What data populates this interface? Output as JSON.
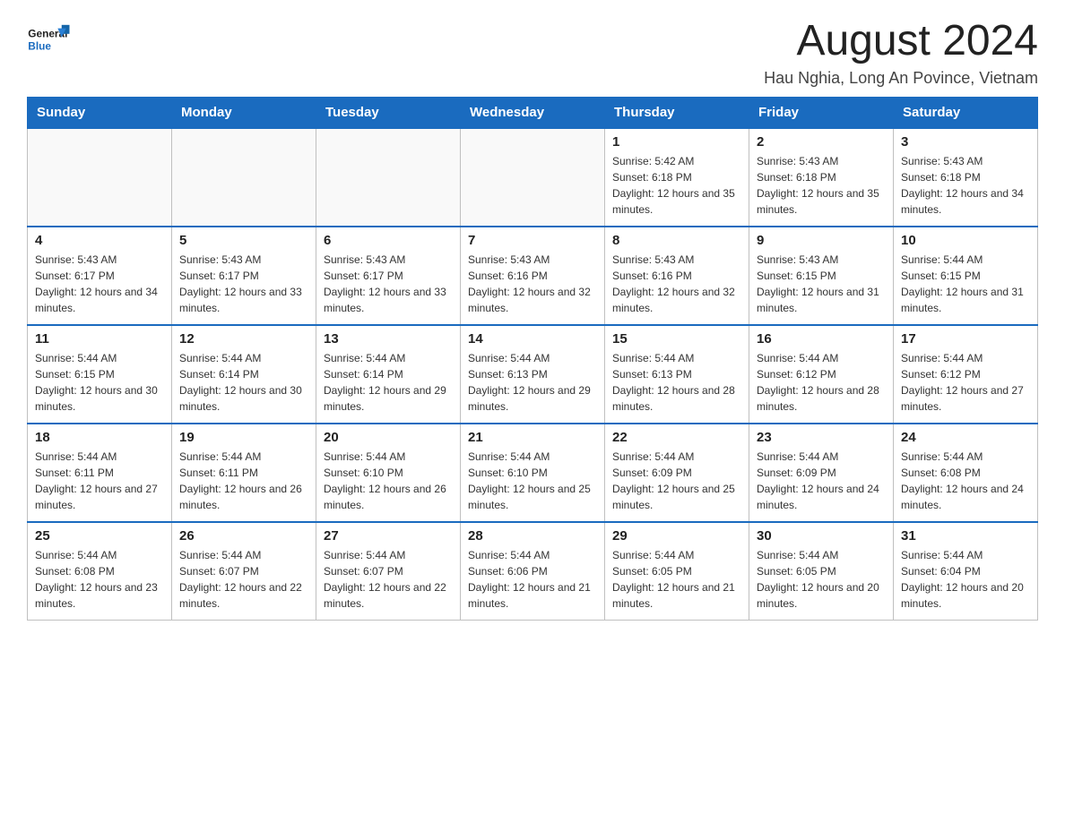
{
  "header": {
    "title": "August 2024",
    "subtitle": "Hau Nghia, Long An Povince, Vietnam"
  },
  "weekdays": [
    "Sunday",
    "Monday",
    "Tuesday",
    "Wednesday",
    "Thursday",
    "Friday",
    "Saturday"
  ],
  "weeks": [
    [
      {
        "day": "",
        "sunrise": "",
        "sunset": "",
        "daylight": ""
      },
      {
        "day": "",
        "sunrise": "",
        "sunset": "",
        "daylight": ""
      },
      {
        "day": "",
        "sunrise": "",
        "sunset": "",
        "daylight": ""
      },
      {
        "day": "",
        "sunrise": "",
        "sunset": "",
        "daylight": ""
      },
      {
        "day": "1",
        "sunrise": "Sunrise: 5:42 AM",
        "sunset": "Sunset: 6:18 PM",
        "daylight": "Daylight: 12 hours and 35 minutes."
      },
      {
        "day": "2",
        "sunrise": "Sunrise: 5:43 AM",
        "sunset": "Sunset: 6:18 PM",
        "daylight": "Daylight: 12 hours and 35 minutes."
      },
      {
        "day": "3",
        "sunrise": "Sunrise: 5:43 AM",
        "sunset": "Sunset: 6:18 PM",
        "daylight": "Daylight: 12 hours and 34 minutes."
      }
    ],
    [
      {
        "day": "4",
        "sunrise": "Sunrise: 5:43 AM",
        "sunset": "Sunset: 6:17 PM",
        "daylight": "Daylight: 12 hours and 34 minutes."
      },
      {
        "day": "5",
        "sunrise": "Sunrise: 5:43 AM",
        "sunset": "Sunset: 6:17 PM",
        "daylight": "Daylight: 12 hours and 33 minutes."
      },
      {
        "day": "6",
        "sunrise": "Sunrise: 5:43 AM",
        "sunset": "Sunset: 6:17 PM",
        "daylight": "Daylight: 12 hours and 33 minutes."
      },
      {
        "day": "7",
        "sunrise": "Sunrise: 5:43 AM",
        "sunset": "Sunset: 6:16 PM",
        "daylight": "Daylight: 12 hours and 32 minutes."
      },
      {
        "day": "8",
        "sunrise": "Sunrise: 5:43 AM",
        "sunset": "Sunset: 6:16 PM",
        "daylight": "Daylight: 12 hours and 32 minutes."
      },
      {
        "day": "9",
        "sunrise": "Sunrise: 5:43 AM",
        "sunset": "Sunset: 6:15 PM",
        "daylight": "Daylight: 12 hours and 31 minutes."
      },
      {
        "day": "10",
        "sunrise": "Sunrise: 5:44 AM",
        "sunset": "Sunset: 6:15 PM",
        "daylight": "Daylight: 12 hours and 31 minutes."
      }
    ],
    [
      {
        "day": "11",
        "sunrise": "Sunrise: 5:44 AM",
        "sunset": "Sunset: 6:15 PM",
        "daylight": "Daylight: 12 hours and 30 minutes."
      },
      {
        "day": "12",
        "sunrise": "Sunrise: 5:44 AM",
        "sunset": "Sunset: 6:14 PM",
        "daylight": "Daylight: 12 hours and 30 minutes."
      },
      {
        "day": "13",
        "sunrise": "Sunrise: 5:44 AM",
        "sunset": "Sunset: 6:14 PM",
        "daylight": "Daylight: 12 hours and 29 minutes."
      },
      {
        "day": "14",
        "sunrise": "Sunrise: 5:44 AM",
        "sunset": "Sunset: 6:13 PM",
        "daylight": "Daylight: 12 hours and 29 minutes."
      },
      {
        "day": "15",
        "sunrise": "Sunrise: 5:44 AM",
        "sunset": "Sunset: 6:13 PM",
        "daylight": "Daylight: 12 hours and 28 minutes."
      },
      {
        "day": "16",
        "sunrise": "Sunrise: 5:44 AM",
        "sunset": "Sunset: 6:12 PM",
        "daylight": "Daylight: 12 hours and 28 minutes."
      },
      {
        "day": "17",
        "sunrise": "Sunrise: 5:44 AM",
        "sunset": "Sunset: 6:12 PM",
        "daylight": "Daylight: 12 hours and 27 minutes."
      }
    ],
    [
      {
        "day": "18",
        "sunrise": "Sunrise: 5:44 AM",
        "sunset": "Sunset: 6:11 PM",
        "daylight": "Daylight: 12 hours and 27 minutes."
      },
      {
        "day": "19",
        "sunrise": "Sunrise: 5:44 AM",
        "sunset": "Sunset: 6:11 PM",
        "daylight": "Daylight: 12 hours and 26 minutes."
      },
      {
        "day": "20",
        "sunrise": "Sunrise: 5:44 AM",
        "sunset": "Sunset: 6:10 PM",
        "daylight": "Daylight: 12 hours and 26 minutes."
      },
      {
        "day": "21",
        "sunrise": "Sunrise: 5:44 AM",
        "sunset": "Sunset: 6:10 PM",
        "daylight": "Daylight: 12 hours and 25 minutes."
      },
      {
        "day": "22",
        "sunrise": "Sunrise: 5:44 AM",
        "sunset": "Sunset: 6:09 PM",
        "daylight": "Daylight: 12 hours and 25 minutes."
      },
      {
        "day": "23",
        "sunrise": "Sunrise: 5:44 AM",
        "sunset": "Sunset: 6:09 PM",
        "daylight": "Daylight: 12 hours and 24 minutes."
      },
      {
        "day": "24",
        "sunrise": "Sunrise: 5:44 AM",
        "sunset": "Sunset: 6:08 PM",
        "daylight": "Daylight: 12 hours and 24 minutes."
      }
    ],
    [
      {
        "day": "25",
        "sunrise": "Sunrise: 5:44 AM",
        "sunset": "Sunset: 6:08 PM",
        "daylight": "Daylight: 12 hours and 23 minutes."
      },
      {
        "day": "26",
        "sunrise": "Sunrise: 5:44 AM",
        "sunset": "Sunset: 6:07 PM",
        "daylight": "Daylight: 12 hours and 22 minutes."
      },
      {
        "day": "27",
        "sunrise": "Sunrise: 5:44 AM",
        "sunset": "Sunset: 6:07 PM",
        "daylight": "Daylight: 12 hours and 22 minutes."
      },
      {
        "day": "28",
        "sunrise": "Sunrise: 5:44 AM",
        "sunset": "Sunset: 6:06 PM",
        "daylight": "Daylight: 12 hours and 21 minutes."
      },
      {
        "day": "29",
        "sunrise": "Sunrise: 5:44 AM",
        "sunset": "Sunset: 6:05 PM",
        "daylight": "Daylight: 12 hours and 21 minutes."
      },
      {
        "day": "30",
        "sunrise": "Sunrise: 5:44 AM",
        "sunset": "Sunset: 6:05 PM",
        "daylight": "Daylight: 12 hours and 20 minutes."
      },
      {
        "day": "31",
        "sunrise": "Sunrise: 5:44 AM",
        "sunset": "Sunset: 6:04 PM",
        "daylight": "Daylight: 12 hours and 20 minutes."
      }
    ]
  ]
}
